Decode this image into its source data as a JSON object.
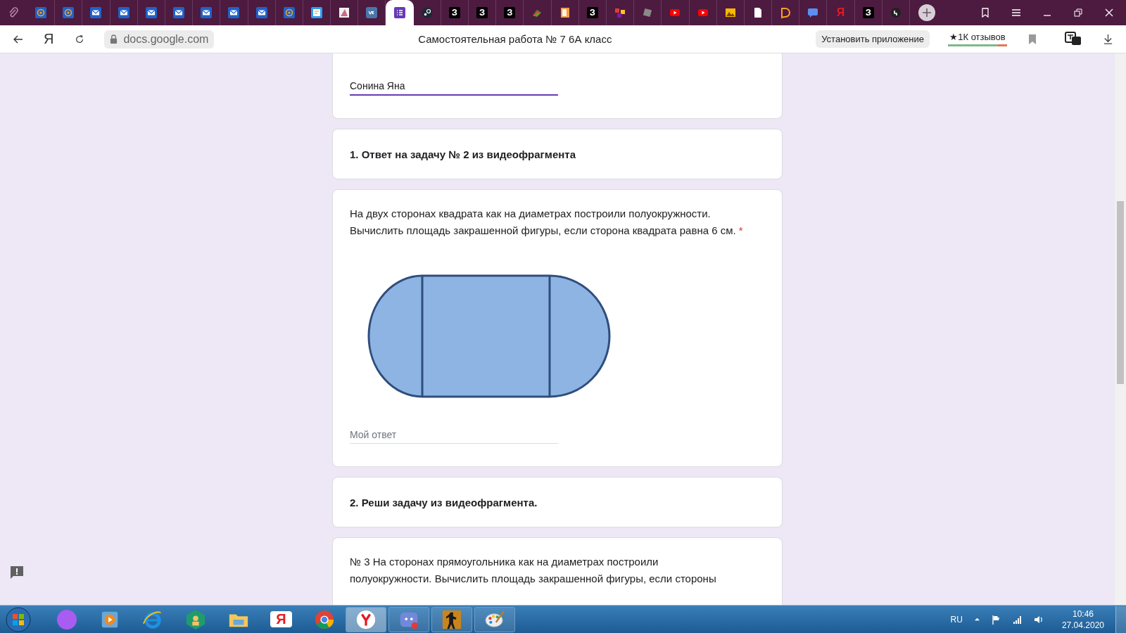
{
  "browser": {
    "tabs": [
      {
        "kind": "at",
        "selected": false
      },
      {
        "kind": "at",
        "selected": false
      },
      {
        "kind": "mail",
        "selected": false
      },
      {
        "kind": "mail",
        "selected": false
      },
      {
        "kind": "mail",
        "selected": false
      },
      {
        "kind": "mail",
        "selected": false
      },
      {
        "kind": "mail",
        "selected": false
      },
      {
        "kind": "mail",
        "selected": false
      },
      {
        "kind": "mail",
        "selected": false
      },
      {
        "kind": "at",
        "selected": false
      },
      {
        "kind": "notes",
        "selected": false
      },
      {
        "kind": "image",
        "selected": false
      },
      {
        "kind": "vk",
        "selected": false
      },
      {
        "kind": "forms",
        "selected": true
      },
      {
        "kind": "steam",
        "selected": false
      },
      {
        "kind": "letter",
        "glyph": "З",
        "selected": false
      },
      {
        "kind": "letter",
        "glyph": "З",
        "selected": false
      },
      {
        "kind": "letter",
        "glyph": "З",
        "selected": false
      },
      {
        "kind": "book",
        "selected": false
      },
      {
        "kind": "orange-book",
        "selected": false
      },
      {
        "kind": "letter",
        "glyph": "З",
        "selected": false
      },
      {
        "kind": "gz",
        "selected": false
      },
      {
        "kind": "roblox",
        "selected": false
      },
      {
        "kind": "youtube",
        "selected": false
      },
      {
        "kind": "youtube",
        "selected": false
      },
      {
        "kind": "picture",
        "selected": false
      },
      {
        "kind": "file",
        "selected": false
      },
      {
        "kind": "d-logo",
        "selected": false
      },
      {
        "kind": "chat",
        "selected": false
      },
      {
        "kind": "yandex",
        "glyph": "Я",
        "selected": false
      },
      {
        "kind": "letter",
        "glyph": "З",
        "selected": false
      },
      {
        "kind": "quote",
        "selected": false
      }
    ],
    "logo": "Я",
    "url": "docs.google.com",
    "page_title": "Самостоятельная работа № 7 6А класс",
    "install_button": "Установить приложение",
    "reviews": "★1К отзывов"
  },
  "form": {
    "name_field": {
      "value": "Сонина Яна"
    },
    "sections": [
      {
        "kind": "header",
        "title": "1. Ответ на задачу № 2 из видеофрагмента"
      },
      {
        "kind": "question",
        "text": "На двух сторонах квадрата как на диаметрах построили полуокружности. Вычислить площадь закрашенной фигуры, если сторона квадрата равна 6 см.",
        "required_mark": "*",
        "has_figure": true,
        "placeholder": "Мой ответ"
      },
      {
        "kind": "header",
        "title": "2. Реши задачу из видеофрагмента."
      },
      {
        "kind": "partial",
        "lines": [
          "№ 3 На сторонах прямоугольника как на диаметрах построили",
          "полуокружности. Вычислить площадь закрашенной фигуры, если стороны"
        ]
      }
    ]
  },
  "taskbar": {
    "pinned": [
      {
        "kind": "alice"
      },
      {
        "kind": "media"
      },
      {
        "kind": "ie"
      },
      {
        "kind": "hexagon"
      },
      {
        "kind": "folder"
      },
      {
        "kind": "yandex",
        "glyph": "Я"
      },
      {
        "kind": "chrome"
      }
    ],
    "windows": [
      {
        "kind": "yandex-browser",
        "selected": true
      },
      {
        "kind": "discord",
        "selected": false
      },
      {
        "kind": "soldier",
        "selected": false
      },
      {
        "kind": "paint",
        "selected": false
      }
    ],
    "language": "RU",
    "time": "10:46",
    "date": "27.04.2020"
  }
}
